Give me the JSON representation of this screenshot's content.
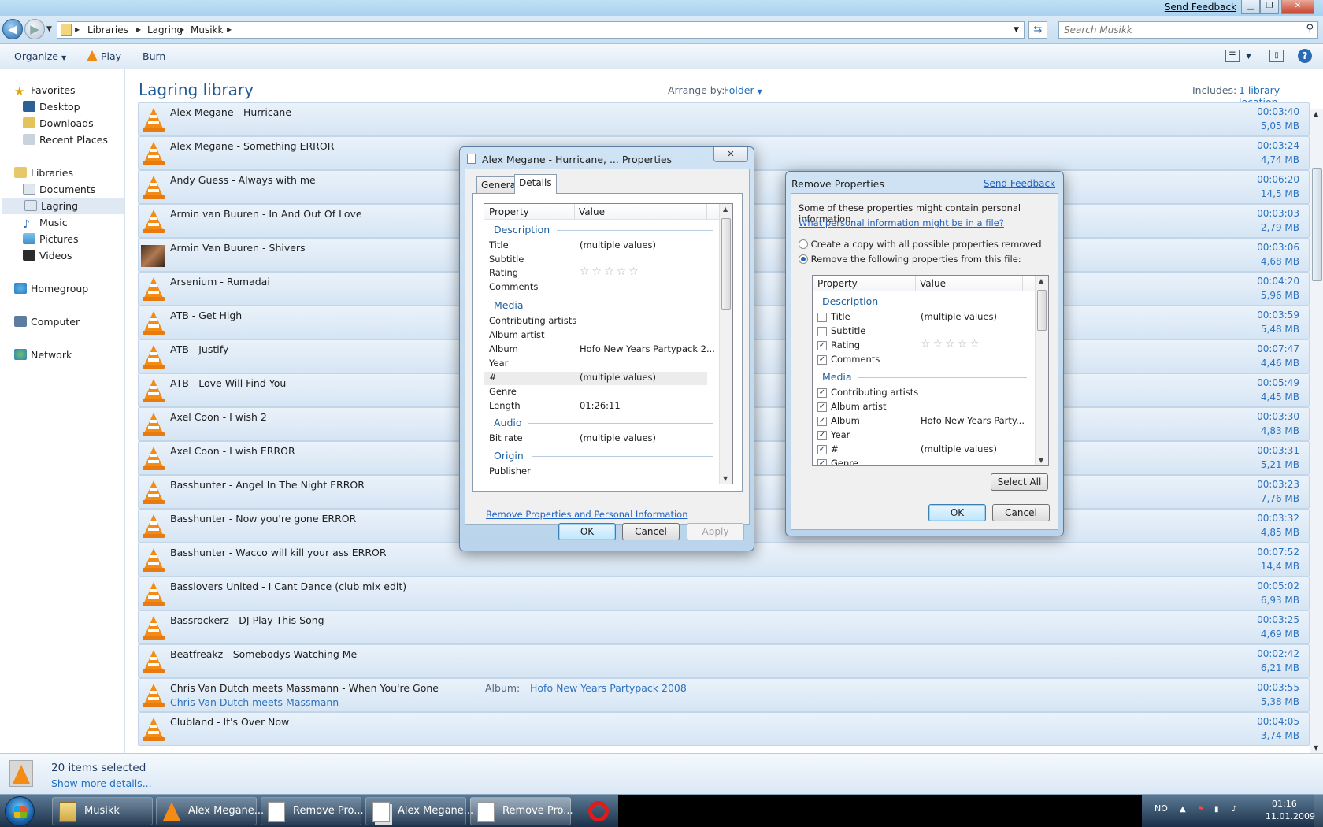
{
  "window": {
    "send_feedback": "Send Feedback",
    "minimize": "▁",
    "maximize": "❐",
    "close": "✕"
  },
  "address": {
    "crumbs": [
      "Libraries",
      "Lagring",
      "Musikk"
    ],
    "search_placeholder": "Search Musikk"
  },
  "toolbar": {
    "organize": "Organize",
    "play": "Play",
    "burn": "Burn"
  },
  "nav": {
    "favorites": "Favorites",
    "desktop": "Desktop",
    "downloads": "Downloads",
    "recent": "Recent Places",
    "libraries": "Libraries",
    "documents": "Documents",
    "lagring": "Lagring",
    "music": "Music",
    "pictures": "Pictures",
    "videos": "Videos",
    "homegroup": "Homegroup",
    "computer": "Computer",
    "network": "Network"
  },
  "library": {
    "title": "Lagring library",
    "arrange_label": "Arrange by:",
    "arrange_value": "Folder",
    "includes_label": "Includes:",
    "includes_value": "1 library location"
  },
  "files": [
    {
      "name": "Alex Megane - Hurricane",
      "duration": "00:03:40",
      "size": "5,05 MB"
    },
    {
      "name": "Alex Megane - Something ERROR",
      "duration": "00:03:24",
      "size": "4,74 MB"
    },
    {
      "name": "Andy Guess - Always with me",
      "duration": "00:06:20",
      "size": "14,5 MB"
    },
    {
      "name": "Armin van Buuren - In And Out Of Love",
      "duration": "00:03:03",
      "size": "2,79 MB"
    },
    {
      "name": "Armin Van Buuren - Shivers",
      "duration": "00:03:06",
      "size": "4,68 MB"
    },
    {
      "name": "Arsenium - Rumadai",
      "duration": "00:04:20",
      "size": "5,96 MB"
    },
    {
      "name": "ATB - Get High",
      "duration": "00:03:59",
      "size": "5,48 MB"
    },
    {
      "name": "ATB - Justify",
      "duration": "00:07:47",
      "size": "4,46 MB"
    },
    {
      "name": "ATB - Love Will Find You",
      "duration": "00:05:49",
      "size": "4,45 MB"
    },
    {
      "name": "Axel Coon - I wish 2",
      "duration": "00:03:30",
      "size": "4,83 MB"
    },
    {
      "name": "Axel Coon - I wish ERROR",
      "duration": "00:03:31",
      "size": "5,21 MB"
    },
    {
      "name": "Basshunter - Angel In The Night ERROR",
      "duration": "00:03:23",
      "size": "7,76 MB"
    },
    {
      "name": "Basshunter - Now you're gone ERROR",
      "duration": "00:03:32",
      "size": "4,85 MB"
    },
    {
      "name": "Basshunter - Wacco will kill your ass ERROR",
      "duration": "00:07:52",
      "size": "14,4 MB"
    },
    {
      "name": "Basslovers United - I Cant Dance (club mix edit)",
      "duration": "00:05:02",
      "size": "6,93 MB"
    },
    {
      "name": "Bassrockerz - DJ Play This Song",
      "duration": "00:03:25",
      "size": "4,69 MB"
    },
    {
      "name": "Beatfreakz - Somebodys Watching Me",
      "duration": "00:02:42",
      "size": "6,21 MB"
    },
    {
      "name": "Chris Van Dutch meets Massmann - When You're Gone",
      "artist": "Chris Van Dutch meets Massmann",
      "album_label": "Album:",
      "album": "Hofo New Years Partypack 2008",
      "duration": "00:03:55",
      "size": "5,38 MB"
    },
    {
      "name": "Clubland - It's Over Now",
      "duration": "00:04:05",
      "size": "3,74 MB"
    }
  ],
  "details_pane": {
    "count": "20 items selected",
    "more": "Show more details..."
  },
  "properties_dialog": {
    "title": "Alex Megane - Hurricane, ... Properties",
    "tab_general": "General",
    "tab_details": "Details",
    "col_property": "Property",
    "col_value": "Value",
    "groups": {
      "description": "Description",
      "media": "Media",
      "audio": "Audio",
      "origin": "Origin"
    },
    "rows": {
      "title": {
        "label": "Title",
        "value": "(multiple values)"
      },
      "subtitle": {
        "label": "Subtitle"
      },
      "rating": {
        "label": "Rating",
        "value": "☆☆☆☆☆"
      },
      "comments": {
        "label": "Comments"
      },
      "contributing": {
        "label": "Contributing artists"
      },
      "album_artist": {
        "label": "Album artist"
      },
      "album": {
        "label": "Album",
        "value": "Hofo New Years Partypack 2..."
      },
      "year": {
        "label": "Year"
      },
      "number": {
        "label": "#",
        "value": "(multiple values)"
      },
      "genre": {
        "label": "Genre"
      },
      "length": {
        "label": "Length",
        "value": "01:26:11"
      },
      "bitrate": {
        "label": "Bit rate",
        "value": "(multiple values)"
      },
      "publisher": {
        "label": "Publisher"
      }
    },
    "remove_link": "Remove Properties and Personal Information",
    "ok": "OK",
    "cancel": "Cancel",
    "apply": "Apply"
  },
  "remove_dialog": {
    "title": "Remove Properties",
    "send_feedback": "Send Feedback",
    "intro": "Some of these properties might contain personal information.",
    "link": "What personal information might be in a file?",
    "option_copy": "Create a copy with all possible properties removed",
    "option_remove": "Remove the following properties from this file:",
    "col_property": "Property",
    "col_value": "Value",
    "groups": {
      "description": "Description",
      "media": "Media"
    },
    "rows": {
      "title": {
        "label": "Title",
        "value": "(multiple values)",
        "checked": false
      },
      "subtitle": {
        "label": "Subtitle",
        "checked": false
      },
      "rating": {
        "label": "Rating",
        "value": "☆☆☆☆☆",
        "checked": true
      },
      "comments": {
        "label": "Comments",
        "checked": true
      },
      "contributing": {
        "label": "Contributing artists",
        "checked": true
      },
      "album_artist": {
        "label": "Album artist",
        "checked": true
      },
      "album": {
        "label": "Album",
        "value": "Hofo New Years Party...",
        "checked": true
      },
      "year": {
        "label": "Year",
        "checked": true
      },
      "number": {
        "label": "#",
        "value": "(multiple values)",
        "checked": true
      },
      "genre": {
        "label": "Genre",
        "checked": true
      }
    },
    "select_all": "Select All",
    "ok": "OK",
    "cancel": "Cancel"
  },
  "taskbar": {
    "tasks": [
      "Musikk",
      "Alex Megane...",
      "Remove Pro...",
      "Alex Megane...",
      "Remove Pro..."
    ],
    "language": "NO",
    "time": "01:16",
    "date": "11.01.2009"
  }
}
